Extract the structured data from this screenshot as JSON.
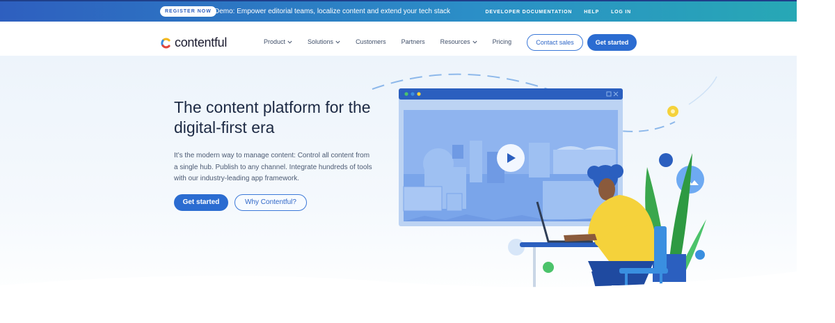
{
  "banner": {
    "badge": "REGISTER NOW",
    "text": "Demo: Empower editorial teams, localize content and extend your tech stack",
    "links": [
      "DEVELOPER DOCUMENTATION",
      "HELP",
      "LOG IN"
    ]
  },
  "nav": {
    "logo_text": "contentful",
    "menu": [
      {
        "label": "Product",
        "dropdown": true
      },
      {
        "label": "Solutions",
        "dropdown": true
      },
      {
        "label": "Customers",
        "dropdown": false
      },
      {
        "label": "Partners",
        "dropdown": false
      },
      {
        "label": "Resources",
        "dropdown": true
      },
      {
        "label": "Pricing",
        "dropdown": false
      }
    ],
    "contact_sales": "Contact sales",
    "get_started": "Get started"
  },
  "hero": {
    "title": "The content platform for the digital-first era",
    "description": "It’s the modern way to manage content: Control all content from a single hub. Publish to any channel. Integrate hundreds of tools with our industry-leading app framework.",
    "primary_button": "Get started",
    "secondary_button": "Why Contentful?"
  },
  "colors": {
    "banner_start": "#2e5fbf",
    "banner_end": "#27a8b5",
    "primary": "#2b6cd1",
    "heading": "#1d2a44",
    "body_text": "#4b5a72"
  },
  "icons": [
    "chevron-down-icon",
    "play-icon",
    "image-icon",
    "gear-icon"
  ]
}
